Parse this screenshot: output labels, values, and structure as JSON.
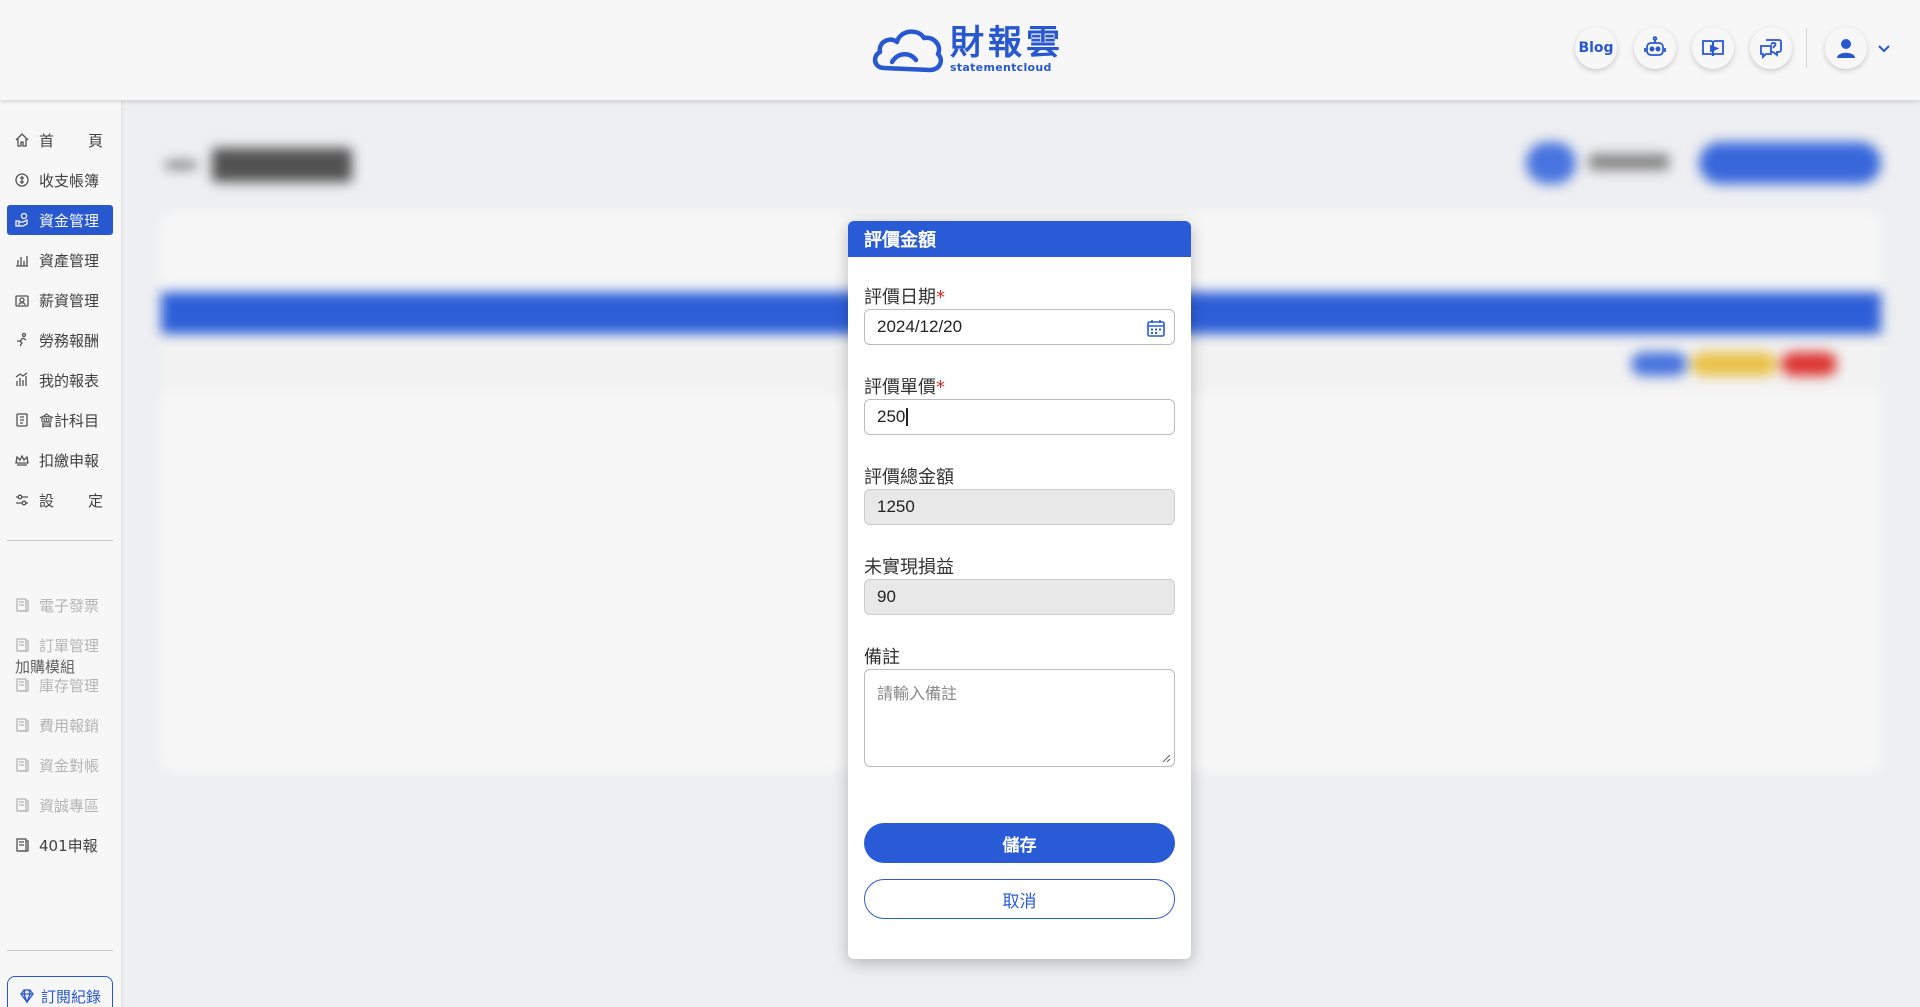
{
  "header": {
    "logo_cn": "財報雲",
    "logo_en": "statementcloud",
    "blog_label": "Blog"
  },
  "sidebar": {
    "items": [
      {
        "label": "首頁",
        "chars": [
          "首",
          "頁"
        ]
      },
      {
        "label": "收支帳簿"
      },
      {
        "label": "資金管理"
      },
      {
        "label": "資產管理"
      },
      {
        "label": "薪資管理"
      },
      {
        "label": "勞務報酬"
      },
      {
        "label": "我的報表"
      },
      {
        "label": "會計科目"
      },
      {
        "label": "扣繳申報"
      },
      {
        "label": "設定",
        "chars": [
          "設",
          "定"
        ]
      }
    ],
    "section_title": "加購模組",
    "addons": [
      {
        "label": "電子發票"
      },
      {
        "label": "訂單管理"
      },
      {
        "label": "庫存管理"
      },
      {
        "label": "費用報銷"
      },
      {
        "label": "資金對帳"
      },
      {
        "label": "資誠專區"
      },
      {
        "label": "401申報"
      }
    ],
    "subscription_label": "訂閱紀錄"
  },
  "modal": {
    "title": "評價金額",
    "date_label": "評價日期",
    "date_value": "2024/12/20",
    "unit_price_label": "評價單價",
    "unit_price_value": "250",
    "total_label": "評價總金額",
    "total_value": "1250",
    "unrealized_label": "未實現損益",
    "unrealized_value": "90",
    "note_label": "備註",
    "note_placeholder": "請輸入備註",
    "required_mark": "*",
    "save_label": "儲存",
    "cancel_label": "取消"
  },
  "colors": {
    "primary": "#2a5bd7",
    "required": "#e02424"
  }
}
